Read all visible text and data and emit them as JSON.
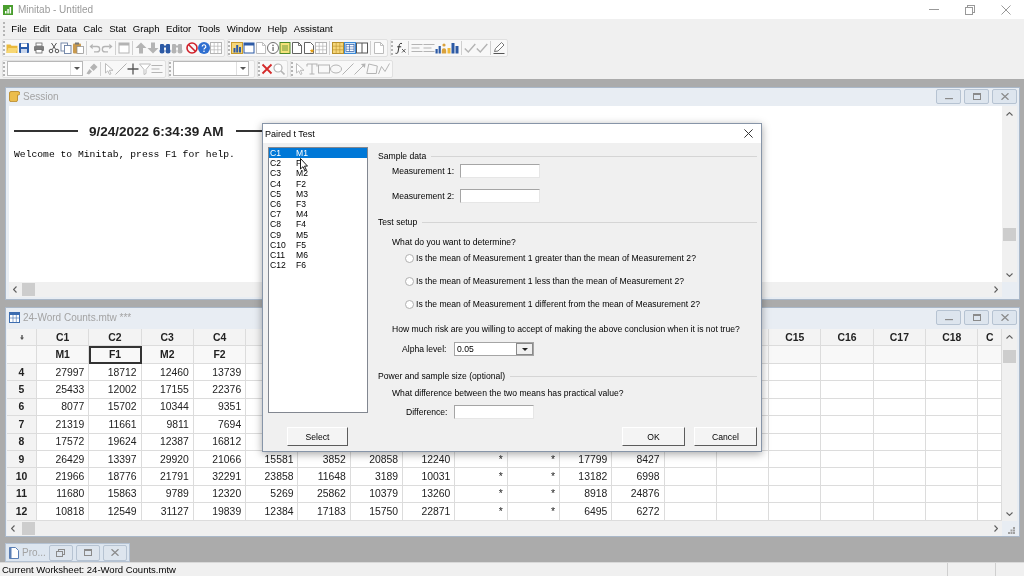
{
  "app": {
    "title": "Minitab - Untitled"
  },
  "menu": [
    "File",
    "Edit",
    "Data",
    "Calc",
    "Stat",
    "Graph",
    "Editor",
    "Tools",
    "Window",
    "Help",
    "Assistant"
  ],
  "session": {
    "title": "Session",
    "timestamp": "9/24/2022 6:34:39 AM",
    "lines": [
      "Welcome to Minitab, press F1 for help."
    ]
  },
  "worksheet": {
    "title": "24-Word Counts.mtw ***",
    "columns_left": [
      {
        "header": "C1",
        "name": "M1",
        "selected": false
      },
      {
        "header": "C2",
        "name": "F1",
        "selected": true
      },
      {
        "header": "C3",
        "name": "M2",
        "selected": false
      },
      {
        "header": "C4",
        "name": "F2",
        "selected": false
      }
    ],
    "columns_right": [
      "C15",
      "C16",
      "C17",
      "C18",
      "C"
    ],
    "rows": [
      {
        "label": "4",
        "cells": [
          "27997",
          "18712",
          "12460",
          "13739"
        ]
      },
      {
        "label": "5",
        "cells": [
          "25433",
          "12002",
          "17155",
          "22376"
        ]
      },
      {
        "label": "6",
        "cells": [
          "8077",
          "15702",
          "10344",
          "9351"
        ]
      },
      {
        "label": "7",
        "cells": [
          "21319",
          "11661",
          "9811",
          "7694"
        ]
      },
      {
        "label": "8",
        "cells": [
          "17572",
          "19624",
          "12387",
          "16812"
        ]
      },
      {
        "label": "9",
        "cells": [
          "26429",
          "13397",
          "29920",
          "21066",
          "15581",
          "3852",
          "20858",
          "12240",
          "*",
          "*",
          "17799",
          "8427"
        ]
      },
      {
        "label": "10",
        "cells": [
          "21966",
          "18776",
          "21791",
          "32291",
          "23858",
          "11648",
          "3189",
          "10031",
          "*",
          "*",
          "13182",
          "6998"
        ]
      },
      {
        "label": "11",
        "cells": [
          "11680",
          "15863",
          "9789",
          "12320",
          "5269",
          "25862",
          "10379",
          "13260",
          "*",
          "*",
          "8918",
          "24876"
        ]
      },
      {
        "label": "12",
        "cells": [
          "10818",
          "12549",
          "31127",
          "19839",
          "12384",
          "17183",
          "15750",
          "22871",
          "*",
          "*",
          "6495",
          "6272"
        ]
      }
    ]
  },
  "minimized_window": {
    "title": "Pro..."
  },
  "status_bar": {
    "text": "Current Worksheet: 24-Word Counts.mtw"
  },
  "dialog": {
    "title": "Paired t Test",
    "column_list": [
      {
        "column": "C1",
        "name": "M1",
        "selected": true
      },
      {
        "column": "C2",
        "name": "F",
        "selected": false
      },
      {
        "column": "C3",
        "name": "M2",
        "selected": false
      },
      {
        "column": "C4",
        "name": "F2",
        "selected": false
      },
      {
        "column": "C5",
        "name": "M3",
        "selected": false
      },
      {
        "column": "C6",
        "name": "F3",
        "selected": false
      },
      {
        "column": "C7",
        "name": "M4",
        "selected": false
      },
      {
        "column": "C8",
        "name": "F4",
        "selected": false
      },
      {
        "column": "C9",
        "name": "M5",
        "selected": false
      },
      {
        "column": "C10",
        "name": "F5",
        "selected": false
      },
      {
        "column": "C11",
        "name": "M6",
        "selected": false
      },
      {
        "column": "C12",
        "name": "F6",
        "selected": false
      }
    ],
    "select_button": "Select",
    "sample_data": {
      "heading": "Sample data",
      "fields": [
        "Measurement 1:",
        "Measurement 2:"
      ]
    },
    "test_setup": {
      "heading": "Test setup",
      "question": "What do you want to determine?",
      "options": [
        {
          "label": "Is the mean of Measurement 1 greater than the mean of Measurement 2?",
          "selected": false
        },
        {
          "label": "Is the mean of Measurement 1 less than the mean of Measurement 2?",
          "selected": false
        },
        {
          "label": "Is the mean of Measurement 1 different from the mean of Measurement 2?",
          "selected": false
        }
      ],
      "risk_question": "How much risk are you willing to accept of making the above conclusion when it is not true?",
      "alpha": {
        "label": "Alpha level:",
        "value": "0.05"
      }
    },
    "power": {
      "heading": "Power and sample size (optional)",
      "question": "What difference between the two means has practical value?",
      "field_label": "Difference:"
    },
    "buttons": [
      "OK",
      "Cancel"
    ]
  }
}
